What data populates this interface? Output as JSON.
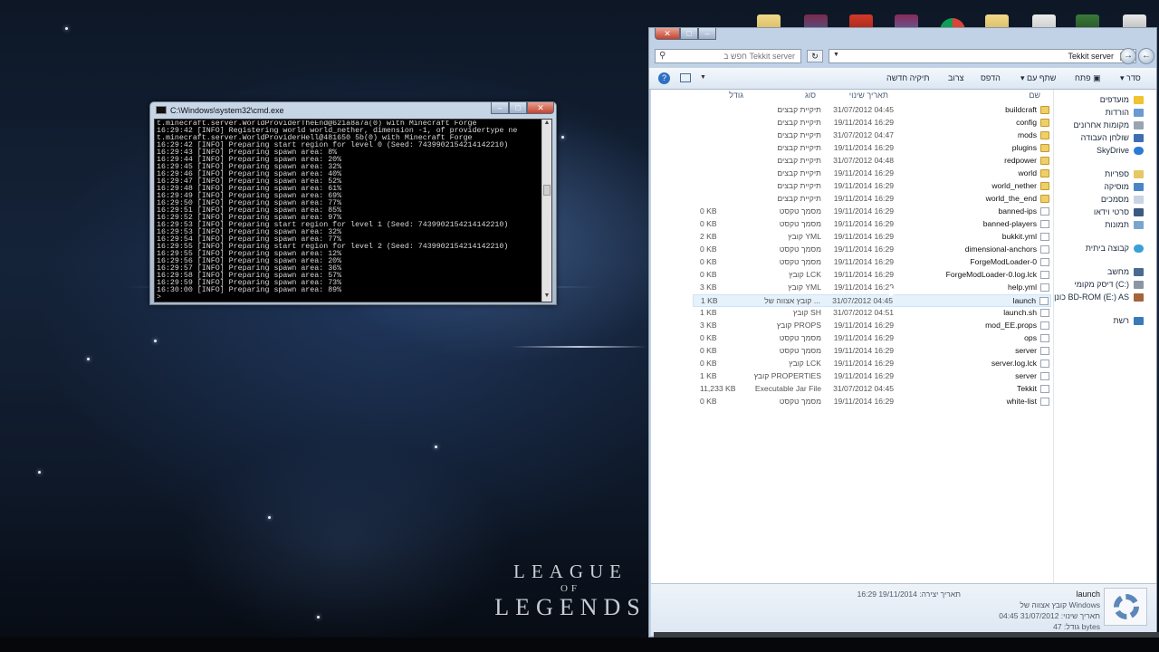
{
  "wallpaper": {
    "line1": "LEAGUE",
    "line2": "OF",
    "line3": "LEGENDS"
  },
  "cmd": {
    "title": "C:\\Windows\\system32\\cmd.exe",
    "lines": [
      "t.minecraft.server.WorldProviderTheEnd@621a8a7a(0) with Minecraft Forge",
      "16:29:42 [INFO] Registering world world_nether, dimension -1, of providertype ne",
      "t.minecraft.server.WorldProviderHell@481650 5b(0) with Minecraft Forge",
      "16:29:42 [INFO] Preparing start region for level 0 (Seed: 7439902154214142210)",
      "16:29:43 [INFO] Preparing spawn area: 8%",
      "16:29:44 [INFO] Preparing spawn area: 20%",
      "16:29:45 [INFO] Preparing spawn area: 32%",
      "16:29:46 [INFO] Preparing spawn area: 40%",
      "16:29:47 [INFO] Preparing spawn area: 52%",
      "16:29:48 [INFO] Preparing spawn area: 61%",
      "16:29:49 [INFO] Preparing spawn area: 69%",
      "16:29:50 [INFO] Preparing spawn area: 77%",
      "16:29:51 [INFO] Preparing spawn area: 85%",
      "16:29:52 [INFO] Preparing spawn area: 97%",
      "16:29:53 [INFO] Preparing start region for level 1 (Seed: 7439902154214142210)",
      "16:29:53 [INFO] Preparing spawn area: 32%",
      "16:29:54 [INFO] Preparing spawn area: 77%",
      "16:29:55 [INFO] Preparing start region for level 2 (Seed: 7439902154214142210)",
      "16:29:55 [INFO] Preparing spawn area: 12%",
      "16:29:56 [INFO] Preparing spawn area: 20%",
      "16:29:57 [INFO] Preparing spawn area: 36%",
      "16:29:58 [INFO] Preparing spawn area: 57%",
      "16:29:59 [INFO] Preparing spawn area: 73%",
      "16:30:00 [INFO] Preparing spawn area: 89%",
      ">"
    ]
  },
  "explorer": {
    "address": "Tekkit server",
    "search_placeholder": "חפש ב Tekkit server",
    "commands": {
      "organize": "סדר",
      "open": "פתח",
      "share": "שתף עם",
      "print": "הדפס",
      "burn": "צרוב",
      "new_folder": "תיקיה חדשה"
    },
    "columns": {
      "name": "שם",
      "date": "תאריך שינוי",
      "type": "סוג",
      "size": "גודל"
    },
    "nav": {
      "favorites": "מועדפים",
      "downloads": "הורדות",
      "recent": "מקומות אחרונים",
      "desktop": "שולחן העבודה",
      "skydrive": "SkyDrive",
      "libraries": "ספריות",
      "music": "מוסיקה",
      "documents": "מסמכים",
      "videos": "סרטי וידאו",
      "pictures": "תמונות",
      "homegroup": "קבוצה ביתית",
      "computer": "מחשב",
      "local_disk": "דיסק מקומי (C:)",
      "cd_drive": "כונן BD-ROM (E:) AS",
      "network": "רשת"
    },
    "files": [
      {
        "name": "buildcraft",
        "date": "31/07/2012 04:45",
        "type": "תיקיית קבצים",
        "size": "",
        "kind": "folder"
      },
      {
        "name": "config",
        "date": "19/11/2014 16:29",
        "type": "תיקיית קבצים",
        "size": "",
        "kind": "folder"
      },
      {
        "name": "mods",
        "date": "31/07/2012 04:47",
        "type": "תיקיית קבצים",
        "size": "",
        "kind": "folder"
      },
      {
        "name": "plugins",
        "date": "19/11/2014 16:29",
        "type": "תיקיית קבצים",
        "size": "",
        "kind": "folder"
      },
      {
        "name": "redpower",
        "date": "31/07/2012 04:48",
        "type": "תיקיית קבצים",
        "size": "",
        "kind": "folder"
      },
      {
        "name": "world",
        "date": "19/11/2014 16:29",
        "type": "תיקיית קבצים",
        "size": "",
        "kind": "folder"
      },
      {
        "name": "world_nether",
        "date": "19/11/2014 16:29",
        "type": "תיקיית קבצים",
        "size": "",
        "kind": "folder"
      },
      {
        "name": "world_the_end",
        "date": "19/11/2014 16:29",
        "type": "תיקיית קבצים",
        "size": "",
        "kind": "folder"
      },
      {
        "name": "banned-ips",
        "date": "19/11/2014 16:29",
        "type": "מסמך טקסט",
        "size": "0 KB",
        "kind": "file"
      },
      {
        "name": "banned-players",
        "date": "19/11/2014 16:29",
        "type": "מסמך טקסט",
        "size": "0 KB",
        "kind": "file"
      },
      {
        "name": "bukkit.yml",
        "date": "19/11/2014 16:29",
        "type": "קובץ YML",
        "size": "2 KB",
        "kind": "file"
      },
      {
        "name": "dimensional-anchors",
        "date": "19/11/2014 16:29",
        "type": "מסמך טקסט",
        "size": "0 KB",
        "kind": "file"
      },
      {
        "name": "ForgeModLoader-0",
        "date": "19/11/2014 16:29",
        "type": "מסמך טקסט",
        "size": "0 KB",
        "kind": "file"
      },
      {
        "name": "ForgeModLoader-0.log.lck",
        "date": "19/11/2014 16:29",
        "type": "קובץ LCK",
        "size": "0 KB",
        "kind": "file"
      },
      {
        "name": "help.yml",
        "date": "19/11/2014 16:29",
        "type": "קובץ YML",
        "size": "3 KB",
        "kind": "file"
      },
      {
        "name": "launch",
        "date": "31/07/2012 04:45",
        "type": "קובץ אצווה של ...",
        "size": "1 KB",
        "kind": "file"
      },
      {
        "name": "launch.sh",
        "date": "31/07/2012 04:51",
        "type": "קובץ SH",
        "size": "1 KB",
        "kind": "file"
      },
      {
        "name": "mod_EE.props",
        "date": "19/11/2014 16:29",
        "type": "קובץ PROPS",
        "size": "3 KB",
        "kind": "file"
      },
      {
        "name": "ops",
        "date": "19/11/2014 16:29",
        "type": "מסמך טקסט",
        "size": "0 KB",
        "kind": "file"
      },
      {
        "name": "server",
        "date": "19/11/2014 16:29",
        "type": "מסמך טקסט",
        "size": "0 KB",
        "kind": "file"
      },
      {
        "name": "server.log.lck",
        "date": "19/11/2014 16:29",
        "type": "קובץ LCK",
        "size": "0 KB",
        "kind": "file"
      },
      {
        "name": "server",
        "date": "19/11/2014 16:29",
        "type": "קובץ PROPERTIES",
        "size": "1 KB",
        "kind": "file"
      },
      {
        "name": "Tekkit",
        "date": "31/07/2012 04:45",
        "type": "Executable Jar File",
        "size": "11,233 KB",
        "kind": "file"
      },
      {
        "name": "white-list",
        "date": "19/11/2014 16:29",
        "type": "מסמך טקסט",
        "size": "0 KB",
        "kind": "file"
      }
    ],
    "details": {
      "name": "launch",
      "type": "קובץ אצווה של Windows",
      "modified": "תאריך שינוי: 31/07/2012 04:45",
      "size": "גודל: 47 bytes",
      "created": "תאריך יצירה: 19/11/2014 16:29"
    }
  }
}
